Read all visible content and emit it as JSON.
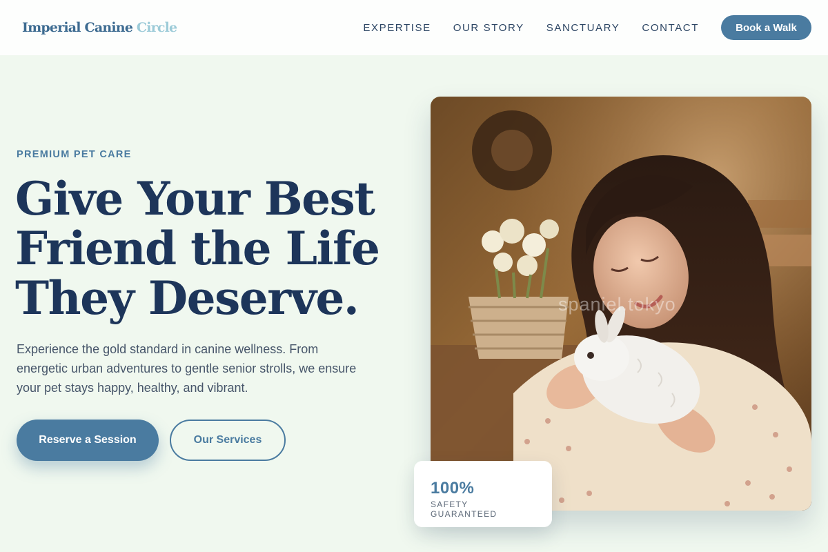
{
  "header": {
    "logo_main": "Imperial Canine ",
    "logo_accent": "Circle",
    "nav": [
      {
        "label": "EXPERTISE"
      },
      {
        "label": "OUR STORY"
      },
      {
        "label": "SANCTUARY"
      },
      {
        "label": "CONTACT"
      }
    ],
    "cta_label": "Book a Walk"
  },
  "hero": {
    "eyebrow": "PREMIUM PET CARE",
    "headline": "Give Your Best Friend the Life They Deserve.",
    "description": "Experience the gold standard in canine wellness. From energetic urban adventures to gentle senior strolls, we ensure your pet stays happy, healthy, and vibrant.",
    "primary_button": "Reserve a Session",
    "secondary_button": "Our Services",
    "image_watermark": "spaniel.tokyo"
  },
  "badge": {
    "value": "100%",
    "label": "SAFETY GUARANTEED"
  },
  "colors": {
    "accent": "#4a7ba0",
    "heading": "#1d355a",
    "background": "#f0f8ef",
    "logo_accent": "#9ccbd8"
  }
}
